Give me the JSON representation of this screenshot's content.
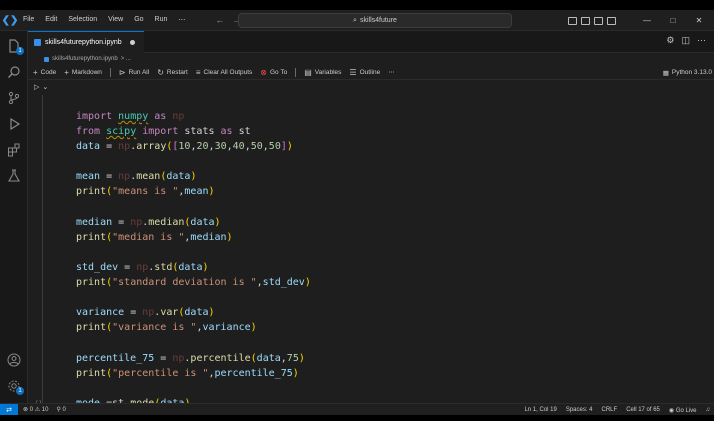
{
  "titlebar": {
    "menu": [
      "File",
      "Edit",
      "Selection",
      "View",
      "Go",
      "Run",
      "⋯"
    ],
    "search_text": "skills4future",
    "window_controls": [
      "—",
      "□",
      "✕"
    ]
  },
  "tab": {
    "label": "skills4futurepython.ipynb",
    "dirty": true
  },
  "breadcrumb": {
    "file": "skills4futurepython.ipynb",
    "rest": "> ..."
  },
  "toolbar": {
    "code": "Code",
    "markdown": "Markdown",
    "run_all": "Run All",
    "restart": "Restart",
    "clear_outputs": "Clear All Outputs",
    "goto": "Go To",
    "variables": "Variables",
    "outline": "Outline",
    "more": "⋯",
    "kernel": "Python 3.13.0"
  },
  "cell": {
    "exec_label": "[ ]",
    "lines": [
      [
        {
          "t": "import ",
          "c": "kw"
        },
        {
          "t": "numpy",
          "c": "mod squig"
        },
        {
          "t": " as ",
          "c": "kw"
        },
        {
          "t": "np",
          "c": "np"
        }
      ],
      [
        {
          "t": "from ",
          "c": "kw"
        },
        {
          "t": "scipy",
          "c": "mod squig"
        },
        {
          "t": " import ",
          "c": "kw"
        },
        {
          "t": "stats",
          "c": "op"
        },
        {
          "t": " as ",
          "c": "kw"
        },
        {
          "t": "st",
          "c": "op"
        }
      ],
      [
        {
          "t": "data",
          "c": "var"
        },
        {
          "t": " = ",
          "c": "op"
        },
        {
          "t": "np",
          "c": "np"
        },
        {
          "t": ".",
          "c": "op"
        },
        {
          "t": "array",
          "c": "fn"
        },
        {
          "t": "(",
          "c": "brk1"
        },
        {
          "t": "[",
          "c": "brk2"
        },
        {
          "t": "10",
          "c": "num"
        },
        {
          "t": ",",
          "c": "op"
        },
        {
          "t": "20",
          "c": "num"
        },
        {
          "t": ",",
          "c": "op"
        },
        {
          "t": "30",
          "c": "num"
        },
        {
          "t": ",",
          "c": "op"
        },
        {
          "t": "40",
          "c": "num"
        },
        {
          "t": ",",
          "c": "op"
        },
        {
          "t": "50",
          "c": "num"
        },
        {
          "t": ",",
          "c": "op"
        },
        {
          "t": "50",
          "c": "num"
        },
        {
          "t": "]",
          "c": "brk2"
        },
        {
          "t": ")",
          "c": "brk1"
        }
      ],
      [],
      [
        {
          "t": "mean",
          "c": "var"
        },
        {
          "t": " = ",
          "c": "op"
        },
        {
          "t": "np",
          "c": "np"
        },
        {
          "t": ".",
          "c": "op"
        },
        {
          "t": "mean",
          "c": "fn"
        },
        {
          "t": "(",
          "c": "brk1"
        },
        {
          "t": "data",
          "c": "var"
        },
        {
          "t": ")",
          "c": "brk1"
        }
      ],
      [
        {
          "t": "print",
          "c": "fn"
        },
        {
          "t": "(",
          "c": "brk1"
        },
        {
          "t": "\"means is \"",
          "c": "str"
        },
        {
          "t": ",",
          "c": "op"
        },
        {
          "t": "mean",
          "c": "var"
        },
        {
          "t": ")",
          "c": "brk1"
        }
      ],
      [],
      [
        {
          "t": "median",
          "c": "var"
        },
        {
          "t": " = ",
          "c": "op"
        },
        {
          "t": "np",
          "c": "np"
        },
        {
          "t": ".",
          "c": "op"
        },
        {
          "t": "median",
          "c": "fn"
        },
        {
          "t": "(",
          "c": "brk1"
        },
        {
          "t": "data",
          "c": "var"
        },
        {
          "t": ")",
          "c": "brk1"
        }
      ],
      [
        {
          "t": "print",
          "c": "fn"
        },
        {
          "t": "(",
          "c": "brk1"
        },
        {
          "t": "\"median is \"",
          "c": "str"
        },
        {
          "t": ",",
          "c": "op"
        },
        {
          "t": "median",
          "c": "var"
        },
        {
          "t": ")",
          "c": "brk1"
        }
      ],
      [],
      [
        {
          "t": "std_dev",
          "c": "var"
        },
        {
          "t": " = ",
          "c": "op"
        },
        {
          "t": "np",
          "c": "np"
        },
        {
          "t": ".",
          "c": "op"
        },
        {
          "t": "std",
          "c": "fn"
        },
        {
          "t": "(",
          "c": "brk1"
        },
        {
          "t": "data",
          "c": "var"
        },
        {
          "t": ")",
          "c": "brk1"
        }
      ],
      [
        {
          "t": "print",
          "c": "fn"
        },
        {
          "t": "(",
          "c": "brk1"
        },
        {
          "t": "\"standard deviation is \"",
          "c": "str"
        },
        {
          "t": ",",
          "c": "op"
        },
        {
          "t": "std_dev",
          "c": "var"
        },
        {
          "t": ")",
          "c": "brk1"
        }
      ],
      [],
      [
        {
          "t": "variance",
          "c": "var"
        },
        {
          "t": " = ",
          "c": "op"
        },
        {
          "t": "np",
          "c": "np"
        },
        {
          "t": ".",
          "c": "op"
        },
        {
          "t": "var",
          "c": "fn"
        },
        {
          "t": "(",
          "c": "brk1"
        },
        {
          "t": "data",
          "c": "var"
        },
        {
          "t": ")",
          "c": "brk1"
        }
      ],
      [
        {
          "t": "print",
          "c": "fn"
        },
        {
          "t": "(",
          "c": "brk1"
        },
        {
          "t": "\"variance is \"",
          "c": "str"
        },
        {
          "t": ",",
          "c": "op"
        },
        {
          "t": "variance",
          "c": "var"
        },
        {
          "t": ")",
          "c": "brk1"
        }
      ],
      [],
      [
        {
          "t": "percentile_75",
          "c": "var"
        },
        {
          "t": " = ",
          "c": "op"
        },
        {
          "t": "np",
          "c": "np"
        },
        {
          "t": ".",
          "c": "op"
        },
        {
          "t": "percentile",
          "c": "fn"
        },
        {
          "t": "(",
          "c": "brk1"
        },
        {
          "t": "data",
          "c": "var"
        },
        {
          "t": ",",
          "c": "op"
        },
        {
          "t": "75",
          "c": "num"
        },
        {
          "t": ")",
          "c": "brk1"
        }
      ],
      [
        {
          "t": "print",
          "c": "fn"
        },
        {
          "t": "(",
          "c": "brk1"
        },
        {
          "t": "\"percentile is \"",
          "c": "str"
        },
        {
          "t": ",",
          "c": "op"
        },
        {
          "t": "percentile_75",
          "c": "var"
        },
        {
          "t": ")",
          "c": "brk1"
        }
      ],
      [],
      [
        {
          "t": "mode",
          "c": "var"
        },
        {
          "t": " =",
          "c": "op"
        },
        {
          "t": "st",
          "c": "op"
        },
        {
          "t": ".",
          "c": "op"
        },
        {
          "t": "mode",
          "c": "fn"
        },
        {
          "t": "(",
          "c": "brk1"
        },
        {
          "t": "data",
          "c": "var"
        },
        {
          "t": ")",
          "c": "brk1"
        }
      ]
    ]
  },
  "statusbar": {
    "errors": "0",
    "warnings": "10",
    "ports": "0",
    "position": "Ln 1, Col 19",
    "spaces": "Spaces: 4",
    "eol": "CRLF",
    "cell": "Cell 17 of 65",
    "golive": "Go Live"
  },
  "colors": {
    "accent": "#0078d4",
    "keyword": "#c586c0",
    "function": "#dcdcaa",
    "variable": "#9cdcfe",
    "string": "#ce9178",
    "number": "#b5cea8"
  }
}
